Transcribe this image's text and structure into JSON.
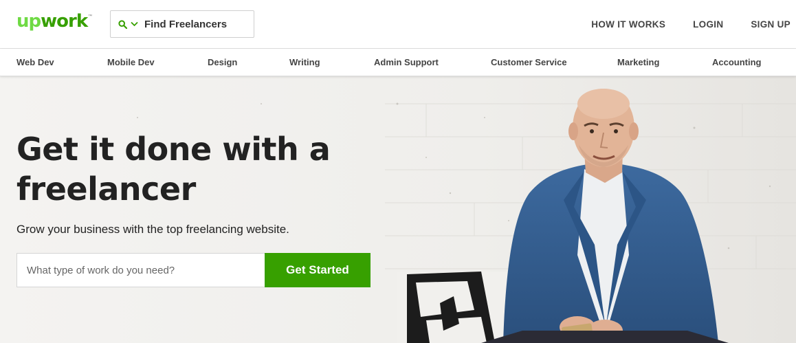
{
  "brand": {
    "logo_prefix": "up",
    "logo_suffix": "work",
    "logo_tm": "™",
    "accent_color": "#6fda44",
    "primary_green": "#37a000"
  },
  "header": {
    "search_label": "Find Freelancers",
    "search_icon": "search-icon",
    "dropdown_icon": "chevron-down-icon",
    "nav": {
      "how_it_works": "HOW IT WORKS",
      "login": "LOGIN",
      "signup": "SIGN UP"
    }
  },
  "categories": [
    "Web Dev",
    "Mobile Dev",
    "Design",
    "Writing",
    "Admin Support",
    "Customer Service",
    "Marketing",
    "Accounting"
  ],
  "hero": {
    "headline_line1": "Get it done with a",
    "headline_line2": "freelancer",
    "subheadline": "Grow your business with the top freelancing website.",
    "input_placeholder": "What type of work do you need?",
    "cta_label": "Get Started"
  }
}
